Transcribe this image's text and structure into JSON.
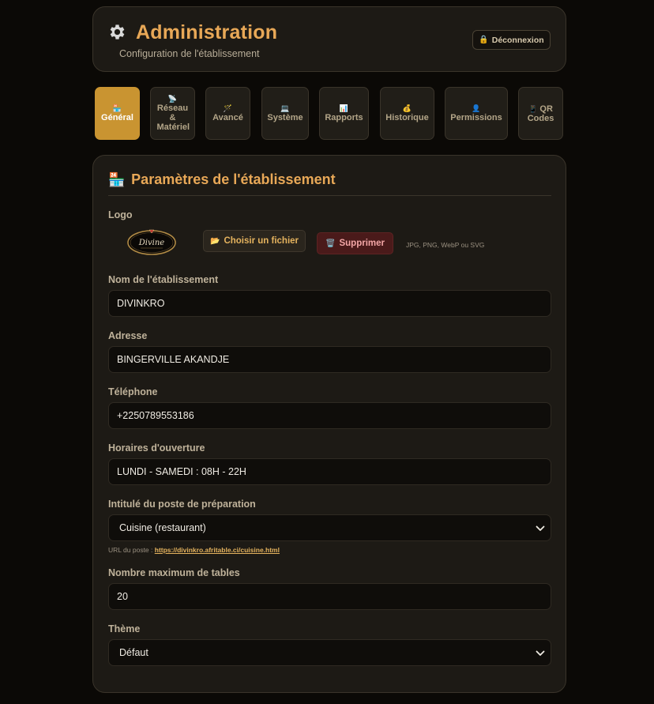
{
  "header": {
    "title": "Administration",
    "subtitle": "Configuration de l'établissement",
    "logout_icon": "lock-icon",
    "logout_label": "Déconnexion",
    "icon": "gear-icon"
  },
  "tabs": [
    {
      "icon": "🏪",
      "label": "Général",
      "active": true
    },
    {
      "icon": "📡",
      "label": "Réseau & Matériel",
      "active": false
    },
    {
      "icon": "🪄",
      "label": "Avancé",
      "active": false
    },
    {
      "icon": "💻",
      "label": "Système",
      "active": false
    },
    {
      "icon": "📊",
      "label": "Rapports",
      "active": false
    },
    {
      "icon": "💰",
      "label": "Historique",
      "active": false
    },
    {
      "icon": "👤",
      "label": "Permissions",
      "active": false
    },
    {
      "icon": "📱",
      "label": "QR Codes",
      "active": false
    }
  ],
  "section": {
    "icon": "🏪",
    "title": "Paramètres de l'établissement"
  },
  "logo": {
    "label": "Logo",
    "choose_icon": "📂",
    "choose_label": "Choisir un fichier",
    "delete_icon": "🗑️",
    "delete_label": "Supprimer",
    "hint": "JPG, PNG, WebP ou SVG",
    "logo_text": "Divine"
  },
  "fields": {
    "name": {
      "label": "Nom de l'établissement",
      "value": "DIVINKRO"
    },
    "address": {
      "label": "Adresse",
      "value": "BINGERVILLE AKANDJE"
    },
    "phone": {
      "label": "Téléphone",
      "value": "+2250789553186"
    },
    "hours": {
      "label": "Horaires d'ouverture",
      "value": "LUNDI - SAMEDI : 08H - 22H"
    },
    "prep_station": {
      "label": "Intitulé du poste de préparation",
      "value": "Cuisine (restaurant)"
    },
    "station_url": {
      "prefix": "URL du poste : ",
      "url": "https://divinkro.afritable.ci/cuisine.html"
    },
    "max_tables": {
      "label": "Nombre maximum de tables",
      "value": "20"
    },
    "theme": {
      "label": "Thème",
      "value": "Défaut"
    }
  },
  "colors": {
    "accent": "#e8a857",
    "active_tab": "#c99431",
    "background": "#0b0906",
    "card": "#1d1a15",
    "danger_bg": "#4a1a1a"
  }
}
